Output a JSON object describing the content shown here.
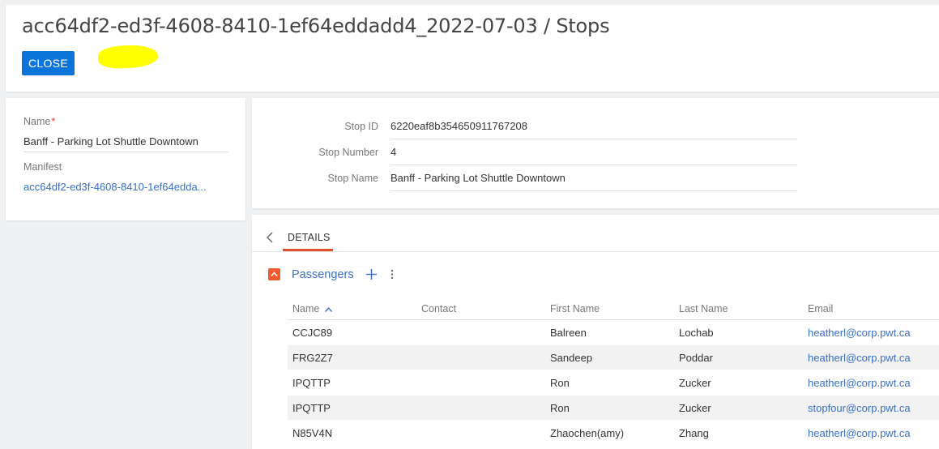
{
  "header": {
    "title": "acc64df2-ed3f-4608-8410-1ef64eddadd4_2022-07-03 / Stops",
    "close_label": "CLOSE"
  },
  "left_panel": {
    "name_label": "Name",
    "name_required_mark": "*",
    "name_value": "Banff - Parking Lot Shuttle Downtown",
    "manifest_label": "Manifest",
    "manifest_value": "acc64df2-ed3f-4608-8410-1ef64edda..."
  },
  "stop_info": {
    "stop_id_label": "Stop ID",
    "stop_id_value": "6220eaf8b354650911767208",
    "stop_number_label": "Stop Number",
    "stop_number_value": "4",
    "stop_name_label": "Stop Name",
    "stop_name_value": "Banff - Parking Lot Shuttle Downtown"
  },
  "details": {
    "tab_label": "DETAILS",
    "section_title": "Passengers",
    "columns": [
      "Name",
      "Contact",
      "First Name",
      "Last Name",
      "Email"
    ],
    "rows": [
      {
        "name": "CCJC89",
        "contact": "",
        "first": "Balreen",
        "last": "Lochab",
        "email": "heatherl@corp.pwt.ca"
      },
      {
        "name": "FRG2Z7",
        "contact": "",
        "first": "Sandeep",
        "last": "Poddar",
        "email": "heatherl@corp.pwt.ca"
      },
      {
        "name": "IPQTTP",
        "contact": "",
        "first": "Ron",
        "last": "Zucker",
        "email": "heatherl@corp.pwt.ca"
      },
      {
        "name": "IPQTTP",
        "contact": "",
        "first": "Ron",
        "last": "Zucker",
        "email": "stopfour@corp.pwt.ca"
      },
      {
        "name": "N85V4N",
        "contact": "",
        "first": "Zhaochen(amy)",
        "last": "Zhang",
        "email": "heatherl@corp.pwt.ca"
      }
    ]
  },
  "colors": {
    "primary_button": "#0c75d9",
    "link": "#3a6fc6",
    "accent": "#f35a30",
    "highlight": "#ffff00"
  }
}
